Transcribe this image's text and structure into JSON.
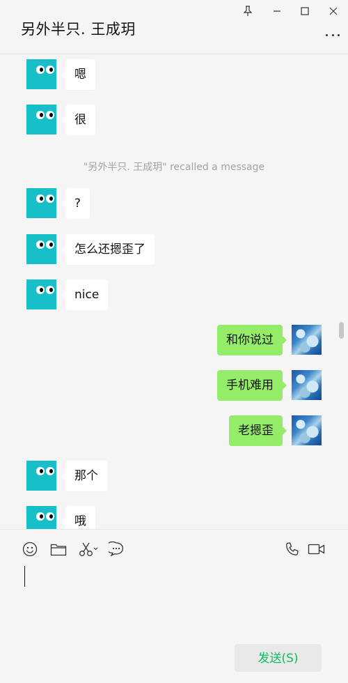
{
  "window": {
    "title": "另外半只. 王成玥"
  },
  "messages": [
    {
      "side": "in",
      "text": "嗯"
    },
    {
      "side": "in",
      "text": "很"
    },
    {
      "side": "system",
      "text": "\"另外半只. 王成玥\" recalled a message"
    },
    {
      "side": "in",
      "text": "?"
    },
    {
      "side": "in",
      "text": "怎么还摁歪了"
    },
    {
      "side": "in",
      "text": "nice"
    },
    {
      "side": "out",
      "text": "和你说过"
    },
    {
      "side": "out",
      "text": "手机难用"
    },
    {
      "side": "out",
      "text": "老摁歪"
    },
    {
      "side": "in",
      "text": "那个"
    },
    {
      "side": "in",
      "text": "哦"
    }
  ],
  "composer": {
    "send_label": "发送(S)",
    "input_value": ""
  },
  "colors": {
    "incoming_bubble": "#ffffff",
    "outgoing_bubble": "#95ec69",
    "bot_avatar": "#17bfc8",
    "send_text": "#07c160"
  },
  "icons": {
    "window_controls": [
      "pin-icon",
      "minimize-icon",
      "maximize-icon",
      "close-icon"
    ],
    "more": "more-icon",
    "toolbar_left": [
      "emoji-icon",
      "folder-icon",
      "scissors-icon",
      "chat-history-icon"
    ],
    "toolbar_right": [
      "phone-icon",
      "video-call-icon"
    ]
  }
}
